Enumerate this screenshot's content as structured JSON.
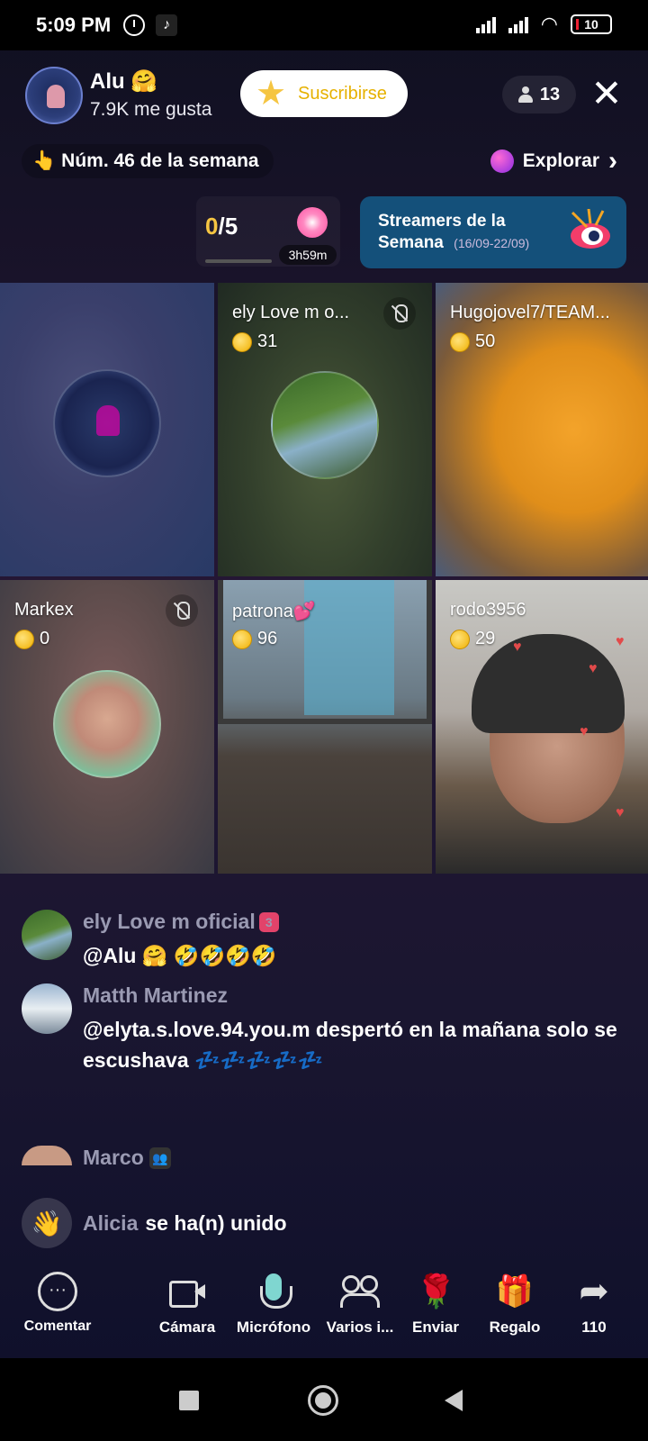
{
  "status_bar": {
    "time": "5:09 PM",
    "battery": "10"
  },
  "header": {
    "host_name": "Alu 🤗",
    "likes": "7.9K me gusta",
    "subscribe_label": "Suscribirse",
    "viewer_count": "13",
    "close_symbol": "✕"
  },
  "ranking": {
    "label": "Núm. 46 de la semana",
    "emoji": "👆"
  },
  "explore": {
    "label": "Explorar",
    "chevron": "›"
  },
  "goal": {
    "current": "0",
    "total": "/5",
    "timer": "3h59m"
  },
  "weekly": {
    "title": "Streamers de la Semana",
    "dates": "(16/09-22/09)"
  },
  "grid": [
    {
      "name": "",
      "coins": ""
    },
    {
      "name": "ely Love m o...",
      "coins": "31"
    },
    {
      "name": "Hugojovel7/TEAM...",
      "coins": "50"
    },
    {
      "name": "Markex",
      "coins": "0"
    },
    {
      "name": "patrona💕",
      "coins": "96"
    },
    {
      "name": "rodo3956",
      "coins": "29"
    }
  ],
  "chat": [
    {
      "name": "ely Love m oficial",
      "badge": "3",
      "text": "@Alu 🤗 🤣🤣🤣🤣"
    },
    {
      "name": "Matth Martinez",
      "text": "@elyta.s.love.94.you.m despertó en la mañana solo  se escushava 💤💤💤💤💤"
    },
    {
      "name": "Marco",
      "badge": "👥"
    }
  ],
  "join": {
    "name": "Alicia",
    "text": "se ha(n) unido"
  },
  "actions": {
    "comment": "Comentar",
    "camera": "Cámara",
    "mic": "Micrófono",
    "guests": "Varios i...",
    "send": "Enviar",
    "gift": "Regalo",
    "share": "110"
  }
}
